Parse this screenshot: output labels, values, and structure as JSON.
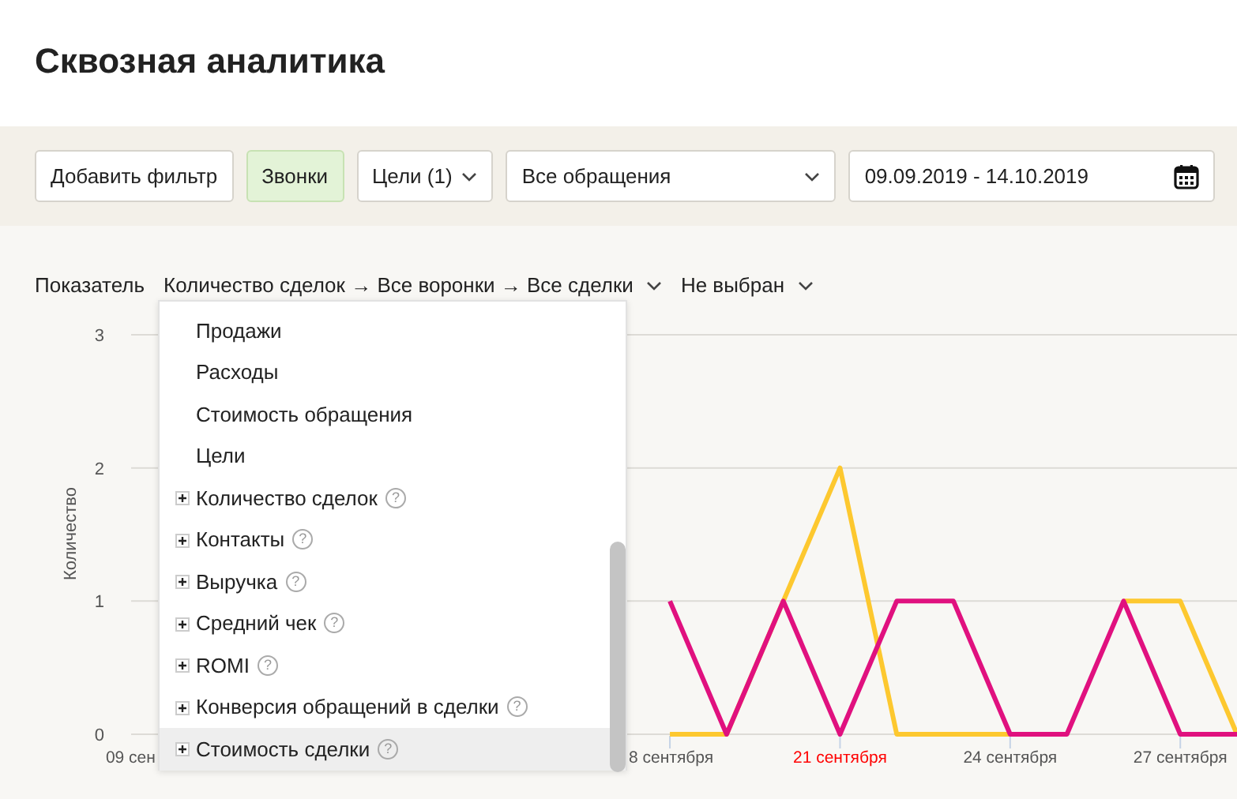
{
  "title": "Сквозная аналитика",
  "filters": [
    {
      "kind": "button",
      "label": "Добавить фильтр",
      "active": false
    },
    {
      "kind": "button",
      "label": "Звонки",
      "active": true
    },
    {
      "kind": "dropdown",
      "label": "Цели (1)"
    },
    {
      "kind": "select",
      "label": "Все обращения"
    },
    {
      "kind": "date",
      "label": "09.09.2019 - 14.10.2019"
    }
  ],
  "indicator": {
    "label": "Показатель",
    "metric": "Количество сделок → Все воронки → Все сделки",
    "secondary": "Не выбран"
  },
  "chart": {
    "partial_tick_labels": [
      "09 сен",
      "8 сентября"
    ],
    "tick_label_styles": [
      {
        "weekend": true
      },
      {
        "weekend": false
      },
      {
        "weekend": false
      }
    ],
    "chart_data": {
      "type": "line",
      "ylabel": "Количество",
      "x": [
        18,
        19,
        20,
        21,
        22,
        23,
        24,
        25,
        26,
        27,
        28
      ],
      "xlim": [
        8.5,
        28
      ],
      "ylim": [
        0,
        3
      ],
      "yticks": [
        0,
        1,
        2,
        3
      ],
      "xticks": [
        {
          "value": 21,
          "label": "21 сентября"
        },
        {
          "value": 24,
          "label": "24 сентября"
        },
        {
          "value": 27,
          "label": "27 сентября"
        }
      ],
      "series": [
        {
          "color": "#fdc82f",
          "values": [
            0,
            0,
            1,
            2,
            0,
            0,
            0,
            null,
            1,
            1,
            0
          ]
        },
        {
          "color": "#e0117f",
          "values": [
            1,
            0,
            1,
            0,
            1,
            1,
            0,
            0,
            1,
            0,
            0
          ]
        }
      ]
    }
  },
  "dropdown": {
    "items": [
      {
        "kind": "plain",
        "label": "Продажи",
        "highlighted": false
      },
      {
        "kind": "plain",
        "label": "Расходы",
        "highlighted": false
      },
      {
        "kind": "plain",
        "label": "Стоимость обращения",
        "highlighted": false
      },
      {
        "kind": "plain",
        "label": "Цели",
        "highlighted": false
      },
      {
        "kind": "group",
        "label": "Количество сделок",
        "hint": "?",
        "highlighted": false
      },
      {
        "kind": "group",
        "label": "Контакты",
        "hint": "?",
        "highlighted": false
      },
      {
        "kind": "group",
        "label": "Выручка",
        "hint": "?",
        "highlighted": false
      },
      {
        "kind": "group",
        "label": "Средний чек",
        "hint": "?",
        "highlighted": false
      },
      {
        "kind": "group",
        "label": "ROMI",
        "hint": "?",
        "highlighted": false
      },
      {
        "kind": "group",
        "label": "Конверсия обращений в сделки",
        "hint": "?",
        "highlighted": false
      },
      {
        "kind": "group",
        "label": "Стоимость сделки",
        "hint": "?",
        "highlighted": true
      }
    ]
  }
}
